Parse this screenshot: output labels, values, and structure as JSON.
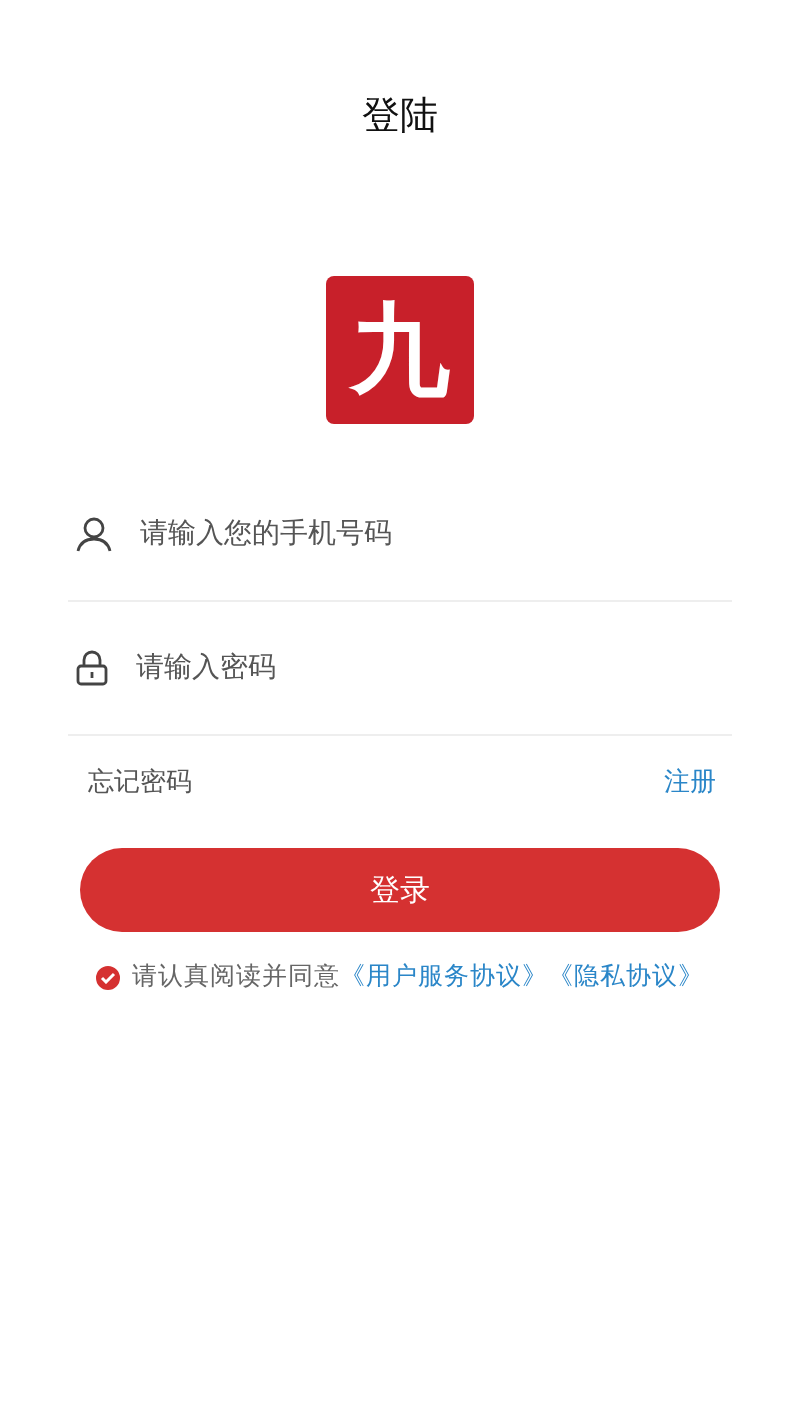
{
  "header": {
    "title": "登陆"
  },
  "logo": {
    "text": "九"
  },
  "fields": [
    {
      "kind": "phone",
      "placeholder": "请输入您的手机号码"
    },
    {
      "kind": "password",
      "placeholder": "请输入密码"
    }
  ],
  "links": {
    "forgot": "忘记密码",
    "register": "注册"
  },
  "login_button": "登录",
  "agreement": {
    "checked": true,
    "text": "请认真阅读并同意",
    "links": [
      "《用户服务协议》",
      "《隐私协议》"
    ]
  }
}
